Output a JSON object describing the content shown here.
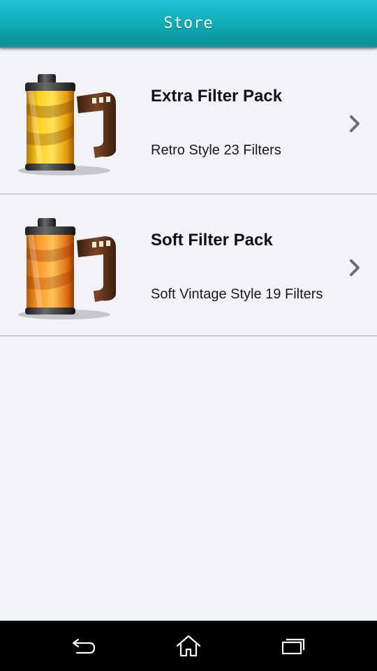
{
  "header": {
    "title": "Store"
  },
  "store_items": [
    {
      "title": "Extra Filter Pack",
      "description": "Retro Style 23 Filters",
      "icon": "film-roll-yellow-icon"
    },
    {
      "title": "Soft Filter Pack",
      "description": "Soft Vintage Style 19 Filters",
      "icon": "film-roll-orange-icon"
    }
  ],
  "navbar": {
    "back_icon": "back-arrow-icon",
    "home_icon": "home-icon",
    "recents_icon": "recent-apps-icon"
  },
  "colors": {
    "header_accent": "#12b3c0",
    "background": "#f2f3f8",
    "navbar": "#000000"
  }
}
